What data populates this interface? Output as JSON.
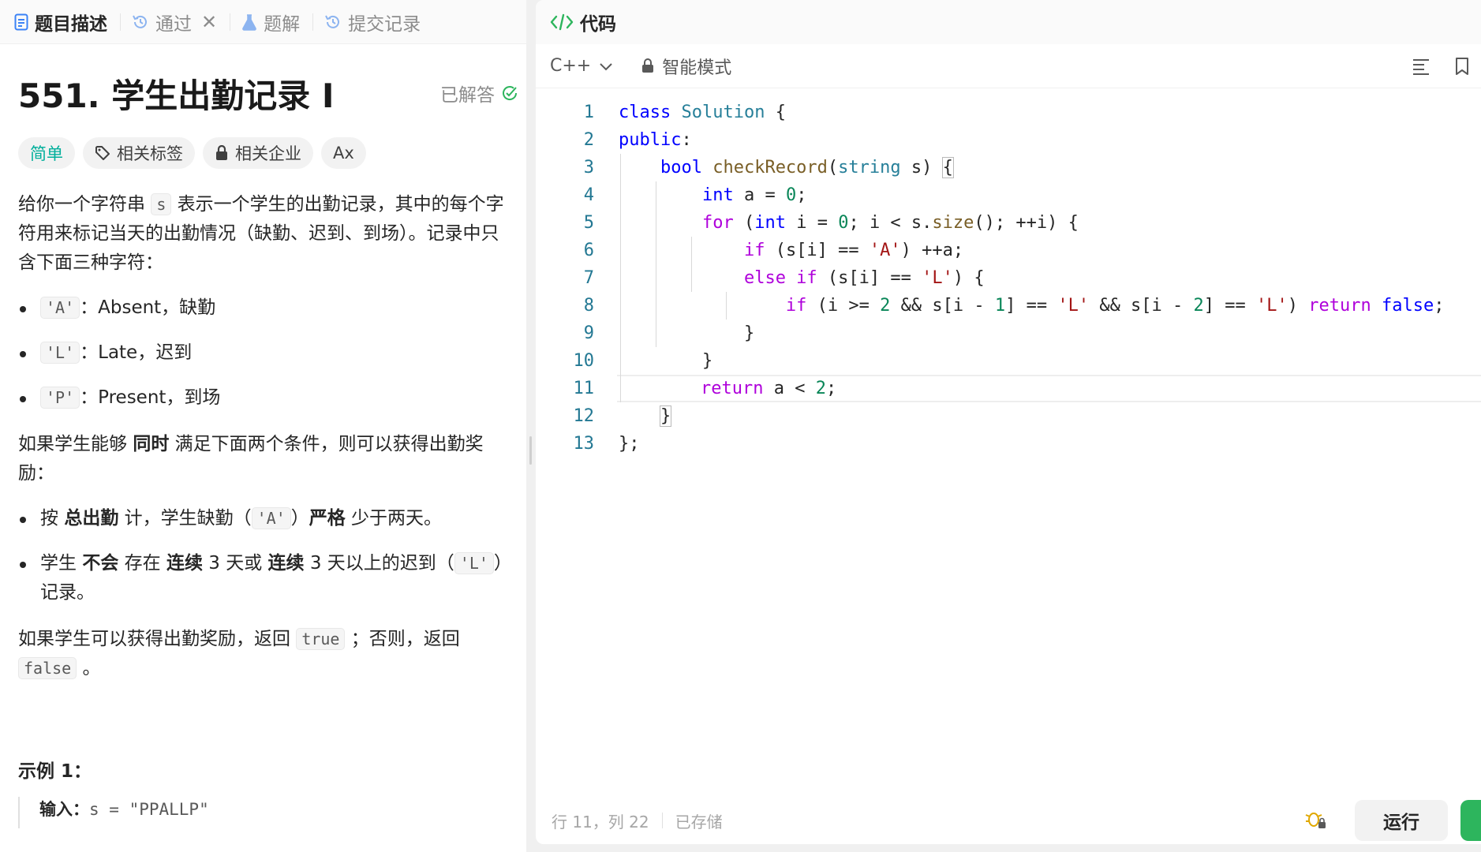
{
  "left_tabs": [
    {
      "label": "题目描述"
    },
    {
      "label": "通过"
    },
    {
      "label": "题解"
    },
    {
      "label": "提交记录"
    }
  ],
  "problem": {
    "title": "551. 学生出勤记录 I",
    "solved_label": "已解答",
    "tags": {
      "difficulty": "简单",
      "related_tags": "相关标签",
      "related_companies": "相关企业",
      "font_toggle": "Ax"
    },
    "intro_a": "给你一个字符串 ",
    "intro_code": "s",
    "intro_b": " 表示一个学生的出勤记录，其中的每个字符用来标记当天的出勤情况（缺勤、迟到、到场）。记录中只含下面三种字符：",
    "chars": [
      {
        "code": "'A'",
        "text": "：Absent，缺勤"
      },
      {
        "code": "'L'",
        "text": "：Late，迟到"
      },
      {
        "code": "'P'",
        "text": "：Present，到场"
      }
    ],
    "cond_a": "如果学生能够 ",
    "cond_bold": "同时",
    "cond_b": " 满足下面两个条件，则可以获得出勤奖励：",
    "rule1": {
      "p1": "按 ",
      "b1": "总出勤",
      "p2": " 计，学生缺勤（",
      "code": "'A'",
      "p3": "）",
      "b2": "严格",
      "p4": " 少于两天。"
    },
    "rule2": {
      "p1": "学生 ",
      "b1": "不会",
      "p2": " 存在 ",
      "b2": "连续",
      "p3": " 3 天或 ",
      "b3": "连续",
      "p4": " 3 天以上的迟到（",
      "code": "'L'",
      "p5": "）记录。"
    },
    "ret_a": "如果学生可以获得出勤奖励，返回 ",
    "ret_true": "true",
    "ret_b": " ；否则，返回 ",
    "ret_false": "false",
    "ret_c": " 。",
    "example_title": "示例 1：",
    "example_input_label": "输入：",
    "example_input_value": "s = \"PPALLP\""
  },
  "editor": {
    "header_title": "代码",
    "language": "C++",
    "mode": "智能模式",
    "line_numbers": [
      "1",
      "2",
      "3",
      "4",
      "5",
      "6",
      "7",
      "8",
      "9",
      "10",
      "11",
      "12",
      "13"
    ],
    "status_position": "行 11，列 22",
    "status_saved": "已存储",
    "run_label": "运行"
  },
  "colors": {
    "easy": "#00af9b",
    "solved_check": "#2db55d",
    "submit": "#2db55d",
    "tab_icon": "#3b82f6"
  }
}
